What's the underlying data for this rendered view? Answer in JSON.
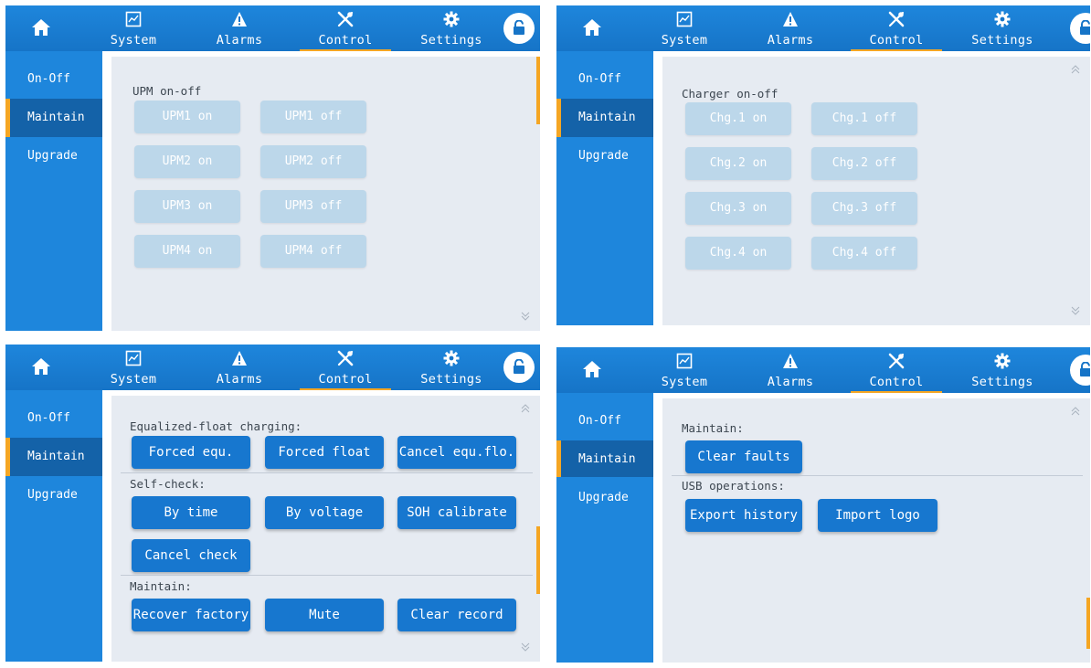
{
  "nav": {
    "tabs": [
      {
        "label": "System",
        "icon": "chart-icon"
      },
      {
        "label": "Alarms",
        "icon": "warning-icon"
      },
      {
        "label": "Control",
        "icon": "tools-icon"
      },
      {
        "label": "Settings",
        "icon": "gear-icon"
      }
    ],
    "active_tab": "Control"
  },
  "sidebar": {
    "items": [
      {
        "label": "On-Off"
      },
      {
        "label": "Maintain"
      },
      {
        "label": "Upgrade"
      }
    ],
    "active": "Maintain"
  },
  "panels": [
    {
      "title": "UPM on-off",
      "buttons": [
        {
          "label": "UPM1 on"
        },
        {
          "label": "UPM1 off"
        },
        {
          "label": "UPM2 on"
        },
        {
          "label": "UPM2 off"
        },
        {
          "label": "UPM3 on"
        },
        {
          "label": "UPM3 off"
        },
        {
          "label": "UPM4 on"
        },
        {
          "label": "UPM4 off"
        }
      ]
    },
    {
      "title": "Charger on-off",
      "buttons": [
        {
          "label": "Chg.1 on"
        },
        {
          "label": "Chg.1 off"
        },
        {
          "label": "Chg.2 on"
        },
        {
          "label": "Chg.2 off"
        },
        {
          "label": "Chg.3 on"
        },
        {
          "label": "Chg.3 off"
        },
        {
          "label": "Chg.4 on"
        },
        {
          "label": "Chg.4 off"
        }
      ]
    },
    {
      "sections": [
        {
          "title": "Equalized-float charging:",
          "buttons": [
            {
              "label": "Forced equ."
            },
            {
              "label": "Forced float"
            },
            {
              "label": "Cancel equ.flo."
            }
          ]
        },
        {
          "title": "Self-check:",
          "buttons": [
            {
              "label": "By time"
            },
            {
              "label": "By voltage"
            },
            {
              "label": "SOH calibrate"
            },
            {
              "label": "Cancel check"
            }
          ]
        },
        {
          "title": "Maintain:",
          "buttons": [
            {
              "label": "Recover factory"
            },
            {
              "label": "Mute"
            },
            {
              "label": "Clear record"
            }
          ]
        }
      ]
    },
    {
      "sections": [
        {
          "title": "Maintain:",
          "buttons": [
            {
              "label": "Clear faults"
            }
          ]
        },
        {
          "title": "USB operations:",
          "buttons": [
            {
              "label": "Export history"
            },
            {
              "label": "Import logo"
            }
          ]
        }
      ]
    }
  ],
  "colors": {
    "nav_blue": "#1e86dc",
    "sidebar_active": "#1462a8",
    "accent_orange": "#f5a623",
    "button_blue": "#1777cf",
    "button_disabled": "#bcd7ea",
    "content_bg": "#e6ebf2"
  }
}
